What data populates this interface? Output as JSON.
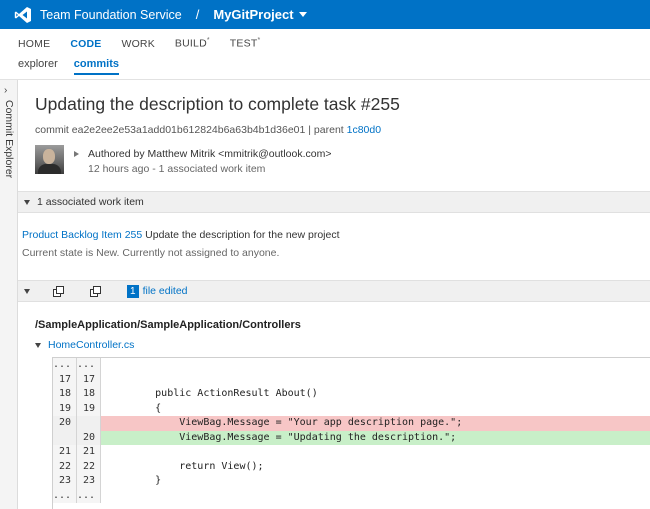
{
  "header": {
    "service_name": "Team Foundation Service",
    "separator": "/",
    "project_name": "MyGitProject"
  },
  "main_nav": {
    "items": [
      {
        "label": "HOME"
      },
      {
        "label": "CODE"
      },
      {
        "label": "WORK"
      },
      {
        "label": "BUILD",
        "marker": "*"
      },
      {
        "label": "TEST",
        "marker": "*"
      }
    ]
  },
  "sub_nav": {
    "items": [
      {
        "label": "explorer"
      },
      {
        "label": "commits"
      }
    ]
  },
  "side_panel": {
    "label": "Commit Explorer",
    "chevron": "›"
  },
  "commit": {
    "title": "Updating the description to complete task #255",
    "commit_label": "commit",
    "commit_id": "ea2e2ee2e53a1add01b612824b6a63b4b1d36e01",
    "parent_label": "| parent",
    "parent_id": "1c80d0",
    "author_line": "Authored by Matthew Mitrik <mmitrik@outlook.com>",
    "time_line": "12 hours ago - 1 associated work item"
  },
  "work_items_section": {
    "header": "1 associated work item",
    "item_link": "Product Backlog Item 255",
    "item_title": "Update the description for the new project",
    "item_state": "Current state is New. Currently not assigned to anyone."
  },
  "files_section": {
    "count": "1",
    "label": "file edited",
    "path": "/SampleApplication/SampleApplication/Controllers",
    "file_name": "HomeController.cs"
  },
  "diff": {
    "lines": [
      {
        "type": "ctx",
        "old": "...",
        "new": "...",
        "text": ""
      },
      {
        "type": "ctx",
        "old": "17",
        "new": "17",
        "text": ""
      },
      {
        "type": "ctx",
        "old": "18",
        "new": "18",
        "text": "        public ActionResult About()"
      },
      {
        "type": "ctx",
        "old": "19",
        "new": "19",
        "text": "        {"
      },
      {
        "type": "del",
        "old": "20",
        "new": "",
        "text": "            ViewBag.Message = \"Your app description page.\";"
      },
      {
        "type": "add",
        "old": "",
        "new": "20",
        "text": "            ViewBag.Message = \"Updating the description.\";"
      },
      {
        "type": "ctx",
        "old": "21",
        "new": "21",
        "text": ""
      },
      {
        "type": "ctx",
        "old": "22",
        "new": "22",
        "text": "            return View();"
      },
      {
        "type": "ctx",
        "old": "23",
        "new": "23",
        "text": "        }"
      },
      {
        "type": "ctx",
        "old": "...",
        "new": "...",
        "text": ""
      }
    ]
  },
  "colors": {
    "brand_blue": "#0072c6",
    "deleted_line": "#f7c6c6",
    "added_line": "#c8efc8"
  }
}
